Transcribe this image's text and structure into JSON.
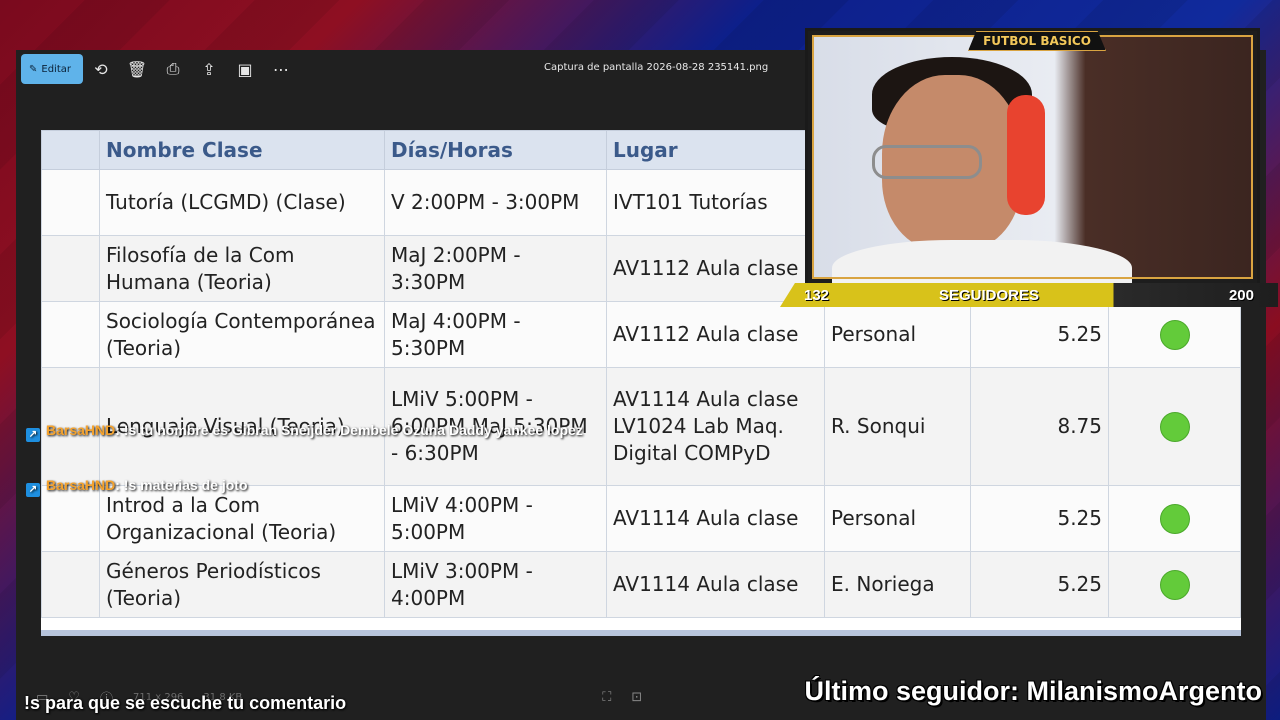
{
  "viewer": {
    "edit_label": "Editar",
    "filename": "Captura de pantalla 2026-08-28 235141.png",
    "status_dimensions": "711 x 296",
    "status_size": "31,8 KB",
    "icons": [
      "edit-icon",
      "rotate-icon",
      "delete-icon",
      "print-icon",
      "share-icon",
      "slideshow-icon",
      "more-icon"
    ]
  },
  "table": {
    "headers": [
      "",
      "Nombre Clase",
      "Días/Horas",
      "Lugar",
      "",
      ""
    ],
    "rows": [
      {
        "nombre": "Tutoría (LCGMD) (Clase)",
        "dias": "V 2:00PM - 3:00PM",
        "lugar": "IVT101 Tutorías",
        "docente": "",
        "uv": "",
        "status": false
      },
      {
        "nombre": "Filosofía de la Com Humana (Teoria)",
        "dias": "MaJ 2:00PM - 3:30PM",
        "lugar": "AV1112 Aula clase",
        "docente": "",
        "uv": "",
        "status": false
      },
      {
        "nombre": "Sociología Contemporánea (Teoria)",
        "dias": "MaJ 4:00PM - 5:30PM",
        "lugar": "AV1112 Aula clase",
        "docente": "Personal",
        "uv": "5.25",
        "status": true
      },
      {
        "nombre": "Lenguaje Visual (Teoria)",
        "dias": "LMiV 5:00PM - 6:00PM MaJ 5:30PM - 6:30PM",
        "lugar": "AV1114 Aula clase LV1024 Lab Maq. Digital COMPyD",
        "docente": "R. Sonqui",
        "uv": "8.75",
        "status": true
      },
      {
        "nombre": "Introd a la Com Organizacional (Teoria)",
        "dias": "LMiV 4:00PM - 5:00PM",
        "lugar": "AV1114 Aula clase",
        "docente": "Personal",
        "uv": "5.25",
        "status": true
      },
      {
        "nombre": "Géneros Periodísticos (Teoria)",
        "dias": "LMiV 3:00PM - 4:00PM",
        "lugar": "AV1114 Aula clase",
        "docente": "E. Noriega",
        "uv": "5.25",
        "status": true
      }
    ]
  },
  "overlay": {
    "cam_title": "FUTBOL BASICO",
    "followers_current": "132",
    "followers_label": "SEGUIDORES",
    "followers_goal": "200",
    "chat": [
      {
        "user": "BarsaHND",
        "text": ": !s tu nombre es Gibran Sneijder Dembele Ozuna Daddy yankee lopez"
      },
      {
        "user": "BarsaHND",
        "text": ": !s materias de joto"
      }
    ],
    "bottom_left": "!s para que se escuche tu comentario",
    "last_follower": "Último seguidor: MilanismoArgento"
  },
  "colors": {
    "edit_button": "#5fb3ea",
    "status_dot": "#63cb3a",
    "header_text": "#3b5a8a",
    "progress_bar": "#d8c21a",
    "chat_user": "#f4a22d"
  }
}
